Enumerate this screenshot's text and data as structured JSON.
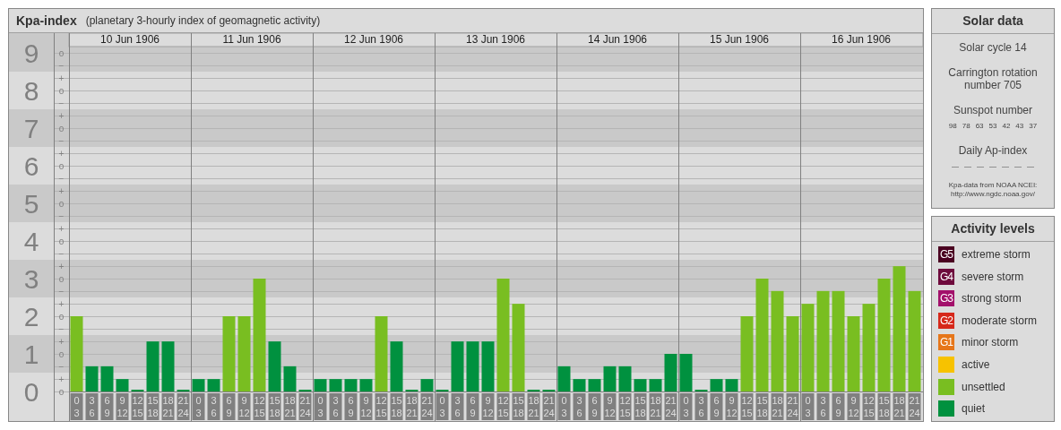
{
  "title": {
    "name": "Kpa-index",
    "subtitle": "(planetary 3-hourly index of geomagnetic activity)"
  },
  "days": [
    "10 Jun 1906",
    "11 Jun 1906",
    "12 Jun 1906",
    "13 Jun 1906",
    "14 Jun 1906",
    "15 Jun 1906",
    "16 Jun 1906"
  ],
  "minor_ticks": [
    "o",
    "−",
    "+",
    "o",
    "−",
    "+",
    "o",
    "−",
    "+",
    "o",
    "−",
    "+",
    "o",
    "−",
    "+",
    "o",
    "−",
    "+",
    "o",
    "−",
    "+",
    "o",
    "−",
    "+",
    "o",
    "−",
    "+",
    "o"
  ],
  "chart_data": {
    "type": "bar",
    "stacked": true,
    "grid": true,
    "ylim": [
      0,
      9.5
    ],
    "yticks": [
      {
        "value": 9,
        "label": "9"
      },
      {
        "value": 8,
        "label": "8"
      },
      {
        "value": 7,
        "label": "7"
      },
      {
        "value": 6,
        "label": "6"
      },
      {
        "value": 5,
        "label": "5"
      },
      {
        "value": 4,
        "label": "4"
      },
      {
        "value": 3,
        "label": "3"
      },
      {
        "value": 2,
        "label": "2"
      },
      {
        "value": 1,
        "label": "1"
      },
      {
        "value": 0,
        "label": "0"
      }
    ],
    "categories": [
      "0\n3",
      "3\n6",
      "6\n9",
      "9\n12",
      "12\n15",
      "15\n18",
      "18\n21",
      "21\n24",
      "0\n3",
      "3\n6",
      "6\n9",
      "9\n12",
      "12\n15",
      "15\n18",
      "18\n21",
      "21\n24",
      "0\n3",
      "3\n6",
      "6\n9",
      "9\n12",
      "12\n15",
      "15\n18",
      "18\n21",
      "21\n24",
      "0\n3",
      "3\n6",
      "6\n9",
      "9\n12",
      "12\n15",
      "15\n18",
      "18\n21",
      "21\n24",
      "0\n3",
      "3\n6",
      "6\n9",
      "9\n12",
      "12\n15",
      "15\n18",
      "18\n21",
      "21\n24",
      "0\n3",
      "3\n6",
      "6\n9",
      "9\n12",
      "12\n15",
      "15\n18",
      "18\n21",
      "21\n24",
      "0\n3",
      "3\n6",
      "6\n9",
      "9\n12",
      "12\n15",
      "15\n18",
      "18\n21",
      "21\n24"
    ],
    "series": [
      {
        "color": "#00913f",
        "values": [
          null,
          0.67,
          0.67,
          0.33,
          0,
          1.33,
          1.33,
          0,
          0.33,
          0.33,
          null,
          null,
          null,
          1.33,
          0.67,
          0,
          0.33,
          0.33,
          0.33,
          0.33,
          null,
          1.33,
          0,
          0.33,
          0,
          1.33,
          1.33,
          1.33,
          null,
          null,
          0,
          0,
          0.67,
          0.33,
          0.33,
          0.67,
          0.67,
          0.33,
          0.33,
          1,
          1,
          0,
          0.33,
          0.33,
          null,
          null,
          null,
          null,
          null,
          null,
          null,
          null,
          null,
          null,
          null,
          null
        ]
      },
      {
        "color": "#79be21",
        "values": [
          2,
          null,
          null,
          null,
          null,
          null,
          null,
          null,
          null,
          null,
          2,
          2,
          3,
          null,
          null,
          null,
          null,
          null,
          null,
          null,
          2,
          null,
          null,
          null,
          null,
          null,
          null,
          null,
          3,
          2.33,
          null,
          null,
          null,
          null,
          null,
          null,
          null,
          null,
          null,
          null,
          null,
          null,
          null,
          null,
          2,
          3,
          2.67,
          2,
          2.33,
          2.67,
          2.67,
          2,
          2.33,
          3,
          3.33,
          2.67
        ]
      }
    ]
  },
  "solar": {
    "title": "Solar data",
    "cycle": "Solar cycle 14",
    "rotation": "Carrington rotation number 705",
    "sunspot_title": "Sunspot number",
    "sunspots": [
      "98",
      "78",
      "63",
      "53",
      "42",
      "43",
      "37"
    ],
    "ap_title": "Daily Ap-index",
    "ap": [
      "—",
      "—",
      "—",
      "—",
      "—",
      "—",
      "—"
    ],
    "source": "Kpa-data from NOAA NCEI: http://www.ngdc.noaa.gov/"
  },
  "legend": {
    "title": "Activity levels",
    "items": [
      {
        "badge": "G5",
        "label": "extreme storm",
        "color": "#4a0020"
      },
      {
        "badge": "G4",
        "label": "severe storm",
        "color": "#6e0a3c"
      },
      {
        "badge": "G3",
        "label": "strong storm",
        "color": "#a3106b"
      },
      {
        "badge": "G2",
        "label": "moderate storm",
        "color": "#d6281a"
      },
      {
        "badge": "G1",
        "label": "minor storm",
        "color": "#e6761a"
      },
      {
        "label": "active",
        "color": "#f7c200"
      },
      {
        "label": "unsettled",
        "color": "#79be21"
      },
      {
        "label": "quiet",
        "color": "#00913f"
      }
    ]
  }
}
